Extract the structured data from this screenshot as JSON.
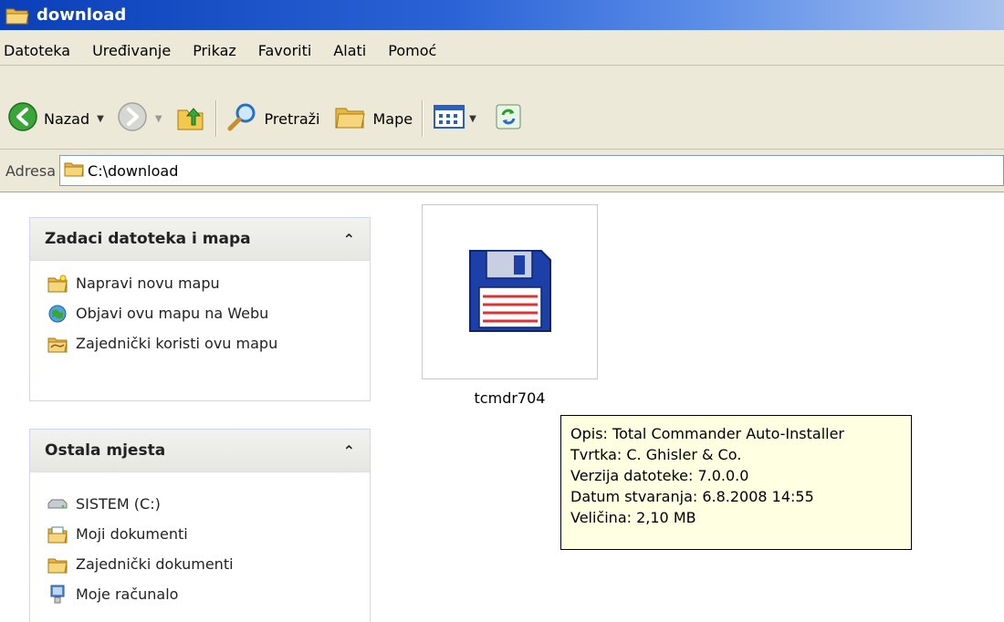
{
  "window": {
    "title": "download"
  },
  "menu": [
    "Datoteka",
    "Uređivanje",
    "Prikaz",
    "Favoriti",
    "Alati",
    "Pomoć"
  ],
  "toolbar": {
    "back_label": "Nazad",
    "search_label": "Pretraži",
    "folders_label": "Mape"
  },
  "address": {
    "label": "Adresa",
    "value": "C:\\download"
  },
  "tasks_panel": {
    "title": "Zadaci datoteka i mapa",
    "items": [
      "Napravi novu mapu",
      "Objavi ovu mapu na Webu",
      "Zajednički koristi ovu mapu"
    ]
  },
  "places_panel": {
    "title": "Ostala mjesta",
    "items": [
      "SISTEM (C:)",
      "Moji dokumenti",
      "Zajednički dokumenti",
      "Moje računalo"
    ]
  },
  "file": {
    "name": "tcmdr704"
  },
  "tooltip": [
    "Opis: Total Commander Auto-Installer",
    "Tvrtka: C. Ghisler & Co.",
    "Verzija datoteke: 7.0.0.0",
    "Datum stvaranja: 6.8.2008 14:55",
    "Veličina: 2,10 MB"
  ]
}
